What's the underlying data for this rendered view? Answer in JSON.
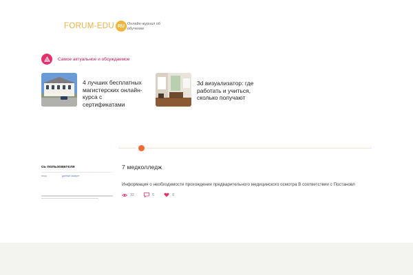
{
  "header": {
    "logo_text": "FORUM-EDU",
    "logo_badge": "RU",
    "tagline": "Онлайн-журнал об обучении"
  },
  "section": {
    "icon": "flame-icon",
    "title": "Самое актуальное и обсуждаемое"
  },
  "cards": [
    {
      "thumb_icon": "building-photo",
      "title": "4 лучших бесплатных магистерских онлайн-курса с сертификатами"
    },
    {
      "thumb_icon": "interior-photo",
      "title": "3d визуализатор: где работать и учиться, сколько получают"
    }
  ],
  "post": {
    "thumb_heading": "сь пользователя",
    "thumb_col_a": "вход",
    "thumb_col_b": "данные аккаунт",
    "title": "7 медколледж",
    "excerpt": "Информация о необходимости прохождения предварительного медицинского осмотра В соответствии с Постановл",
    "views": "32",
    "comments": "6",
    "likes": "6"
  },
  "colors": {
    "brand": "#f0b53a",
    "accent_pink": "#e2316b",
    "divider_dot": "#f26a2e"
  }
}
